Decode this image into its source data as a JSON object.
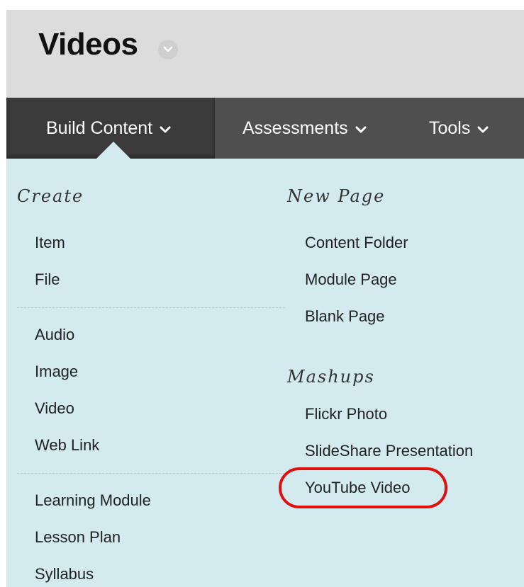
{
  "header": {
    "title": "Videos",
    "title_menu_icon": "chevron-down-icon"
  },
  "navbar": {
    "tabs": [
      {
        "label": "Build Content",
        "active": true
      },
      {
        "label": "Assessments",
        "active": false
      },
      {
        "label": "Tools",
        "active": false
      }
    ]
  },
  "menu": {
    "create": {
      "heading": "Create",
      "groups": [
        [
          "Item",
          "File"
        ],
        [
          "Audio",
          "Image",
          "Video",
          "Web Link"
        ],
        [
          "Learning Module",
          "Lesson Plan",
          "Syllabus"
        ]
      ]
    },
    "new_page": {
      "heading": "New Page",
      "items": [
        "Content Folder",
        "Module Page",
        "Blank Page"
      ]
    },
    "mashups": {
      "heading": "Mashups",
      "items": [
        "Flickr Photo",
        "SlideShare Presentation",
        "YouTube Video"
      ]
    },
    "highlighted_item": "YouTube Video"
  },
  "colors": {
    "header_bg": "#dcdcdc",
    "navbar_bg": "#4f4f4f",
    "active_tab_bg": "#3b3b3b",
    "panel_bg": "#d3eaef",
    "highlight_ring": "#e01010"
  }
}
